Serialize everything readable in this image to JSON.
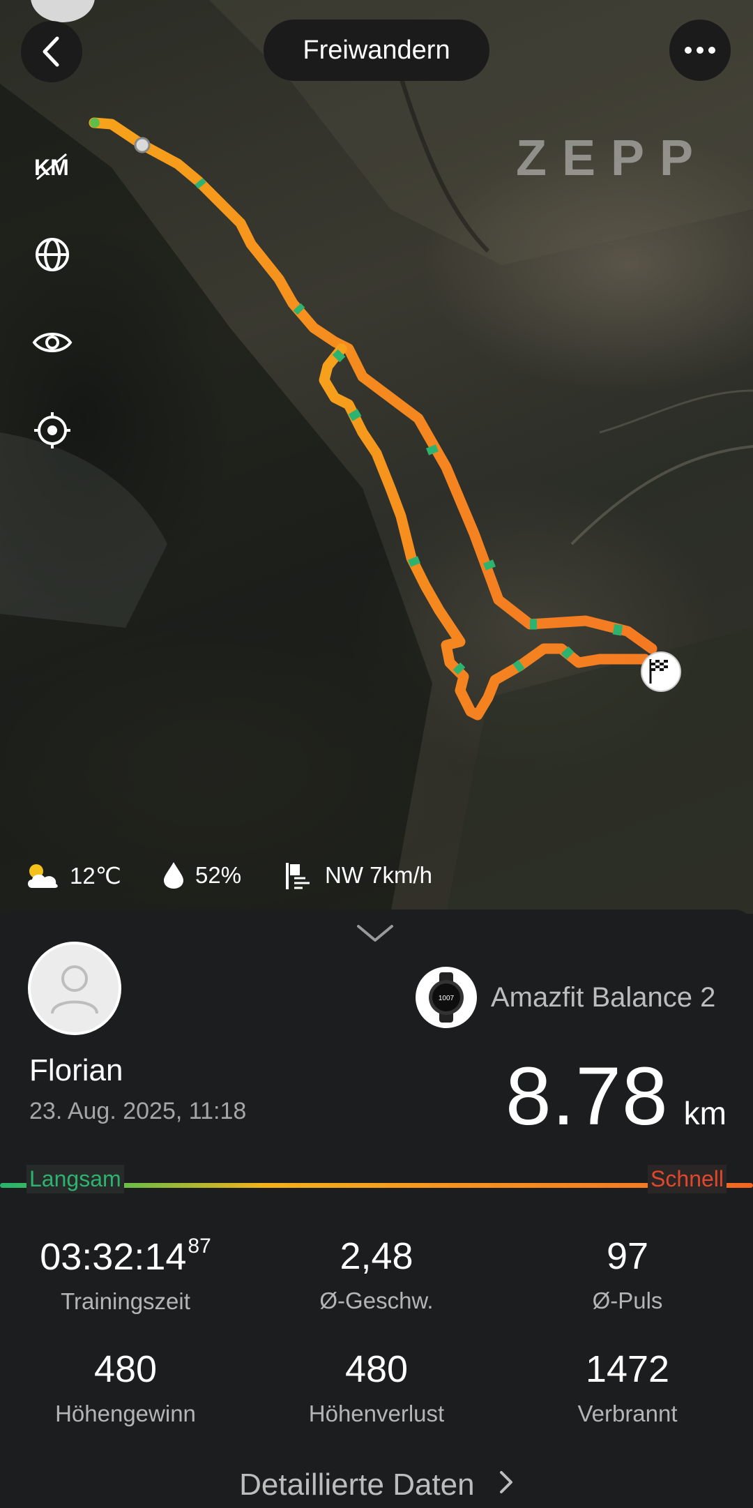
{
  "header": {
    "title": "Freiwandern"
  },
  "brand": {
    "logo_text": "ZEPP"
  },
  "map_controls": [
    "km-icon",
    "globe-icon",
    "eye-icon",
    "locate-icon"
  ],
  "weather": {
    "temperature": "12℃",
    "humidity": "52%",
    "wind": "NW 7km/h"
  },
  "user": {
    "name": "Florian",
    "date": "23. Aug. 2025, 11:18"
  },
  "device": {
    "name": "Amazfit Balance 2"
  },
  "distance": {
    "value": "8.78",
    "unit": "km"
  },
  "speed_legend": {
    "slow": "Langsam",
    "fast": "Schnell"
  },
  "stats": [
    {
      "value": "03:32:14",
      "sup": "87",
      "label": "Trainingszeit"
    },
    {
      "value": "2,48",
      "sup": "",
      "label": "Ø-Geschw."
    },
    {
      "value": "97",
      "sup": "",
      "label": "Ø-Puls"
    },
    {
      "value": "480",
      "sup": "",
      "label": "Höhengewinn"
    },
    {
      "value": "480",
      "sup": "",
      "label": "Höhenverlust"
    },
    {
      "value": "1472",
      "sup": "",
      "label": "Verbrannt"
    }
  ],
  "footer": {
    "details_label": "Detaillierte Daten"
  },
  "colors": {
    "route_slow": "#2db36f",
    "route_mid": "#f7a21b",
    "route_fast": "#f26522",
    "fast_label": "#e0482e"
  }
}
